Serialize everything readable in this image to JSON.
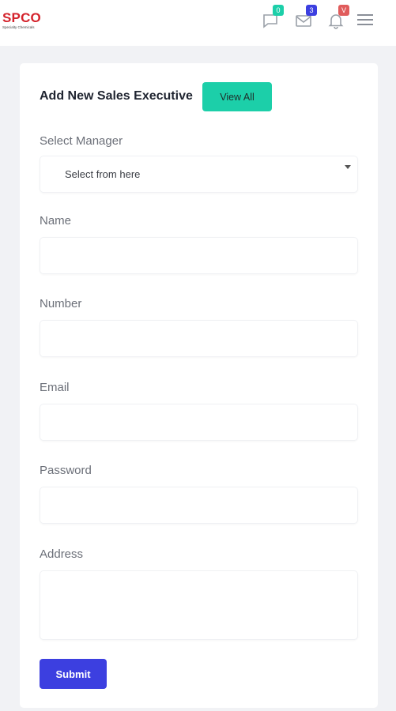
{
  "brand": {
    "name": "SPCO",
    "tagline": "Specialty Chemicals",
    "color": "#d4232c"
  },
  "topbar": {
    "chat": {
      "icon": "chat-icon",
      "count": "0",
      "badge_color": "#1ccfa9"
    },
    "mail": {
      "icon": "mail-icon",
      "count": "3",
      "badge_color": "#3c3fe0"
    },
    "bell": {
      "icon": "bell-icon",
      "count": "V",
      "badge_color": "#e05c5c"
    },
    "menu": {
      "icon": "hamburger-menu-icon"
    }
  },
  "form": {
    "title": "Add New Sales Executive",
    "view_all_label": "View All",
    "manager_label": "Select Manager",
    "manager_selected": "Select from here",
    "name_label": "Name",
    "number_label": "Number",
    "email_label": "Email",
    "password_label": "Password",
    "address_label": "Address",
    "submit_label": "Submit"
  },
  "colors": {
    "accent_teal": "#1ccfa9",
    "primary_blue": "#3c3fe0",
    "background": "#f1f2f5"
  }
}
